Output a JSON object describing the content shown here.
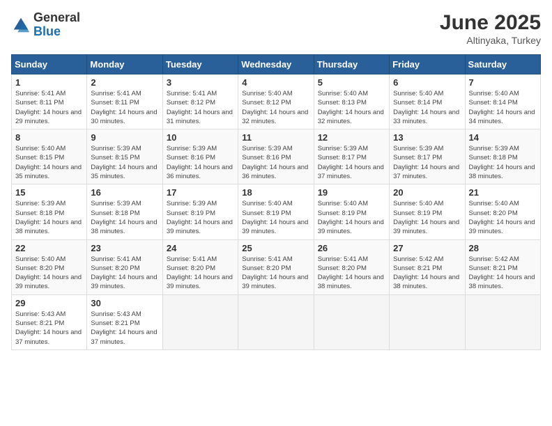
{
  "header": {
    "logo_general": "General",
    "logo_blue": "Blue",
    "month": "June 2025",
    "location": "Altinyaka, Turkey"
  },
  "weekdays": [
    "Sunday",
    "Monday",
    "Tuesday",
    "Wednesday",
    "Thursday",
    "Friday",
    "Saturday"
  ],
  "weeks": [
    [
      {
        "day": "1",
        "sunrise": "5:41 AM",
        "sunset": "8:11 PM",
        "daylight": "14 hours and 29 minutes."
      },
      {
        "day": "2",
        "sunrise": "5:41 AM",
        "sunset": "8:11 PM",
        "daylight": "14 hours and 30 minutes."
      },
      {
        "day": "3",
        "sunrise": "5:41 AM",
        "sunset": "8:12 PM",
        "daylight": "14 hours and 31 minutes."
      },
      {
        "day": "4",
        "sunrise": "5:40 AM",
        "sunset": "8:12 PM",
        "daylight": "14 hours and 32 minutes."
      },
      {
        "day": "5",
        "sunrise": "5:40 AM",
        "sunset": "8:13 PM",
        "daylight": "14 hours and 32 minutes."
      },
      {
        "day": "6",
        "sunrise": "5:40 AM",
        "sunset": "8:14 PM",
        "daylight": "14 hours and 33 minutes."
      },
      {
        "day": "7",
        "sunrise": "5:40 AM",
        "sunset": "8:14 PM",
        "daylight": "14 hours and 34 minutes."
      }
    ],
    [
      {
        "day": "8",
        "sunrise": "5:40 AM",
        "sunset": "8:15 PM",
        "daylight": "14 hours and 35 minutes."
      },
      {
        "day": "9",
        "sunrise": "5:39 AM",
        "sunset": "8:15 PM",
        "daylight": "14 hours and 35 minutes."
      },
      {
        "day": "10",
        "sunrise": "5:39 AM",
        "sunset": "8:16 PM",
        "daylight": "14 hours and 36 minutes."
      },
      {
        "day": "11",
        "sunrise": "5:39 AM",
        "sunset": "8:16 PM",
        "daylight": "14 hours and 36 minutes."
      },
      {
        "day": "12",
        "sunrise": "5:39 AM",
        "sunset": "8:17 PM",
        "daylight": "14 hours and 37 minutes."
      },
      {
        "day": "13",
        "sunrise": "5:39 AM",
        "sunset": "8:17 PM",
        "daylight": "14 hours and 37 minutes."
      },
      {
        "day": "14",
        "sunrise": "5:39 AM",
        "sunset": "8:18 PM",
        "daylight": "14 hours and 38 minutes."
      }
    ],
    [
      {
        "day": "15",
        "sunrise": "5:39 AM",
        "sunset": "8:18 PM",
        "daylight": "14 hours and 38 minutes."
      },
      {
        "day": "16",
        "sunrise": "5:39 AM",
        "sunset": "8:18 PM",
        "daylight": "14 hours and 38 minutes."
      },
      {
        "day": "17",
        "sunrise": "5:39 AM",
        "sunset": "8:19 PM",
        "daylight": "14 hours and 39 minutes."
      },
      {
        "day": "18",
        "sunrise": "5:40 AM",
        "sunset": "8:19 PM",
        "daylight": "14 hours and 39 minutes."
      },
      {
        "day": "19",
        "sunrise": "5:40 AM",
        "sunset": "8:19 PM",
        "daylight": "14 hours and 39 minutes."
      },
      {
        "day": "20",
        "sunrise": "5:40 AM",
        "sunset": "8:19 PM",
        "daylight": "14 hours and 39 minutes."
      },
      {
        "day": "21",
        "sunrise": "5:40 AM",
        "sunset": "8:20 PM",
        "daylight": "14 hours and 39 minutes."
      }
    ],
    [
      {
        "day": "22",
        "sunrise": "5:40 AM",
        "sunset": "8:20 PM",
        "daylight": "14 hours and 39 minutes."
      },
      {
        "day": "23",
        "sunrise": "5:41 AM",
        "sunset": "8:20 PM",
        "daylight": "14 hours and 39 minutes."
      },
      {
        "day": "24",
        "sunrise": "5:41 AM",
        "sunset": "8:20 PM",
        "daylight": "14 hours and 39 minutes."
      },
      {
        "day": "25",
        "sunrise": "5:41 AM",
        "sunset": "8:20 PM",
        "daylight": "14 hours and 39 minutes."
      },
      {
        "day": "26",
        "sunrise": "5:41 AM",
        "sunset": "8:20 PM",
        "daylight": "14 hours and 38 minutes."
      },
      {
        "day": "27",
        "sunrise": "5:42 AM",
        "sunset": "8:21 PM",
        "daylight": "14 hours and 38 minutes."
      },
      {
        "day": "28",
        "sunrise": "5:42 AM",
        "sunset": "8:21 PM",
        "daylight": "14 hours and 38 minutes."
      }
    ],
    [
      {
        "day": "29",
        "sunrise": "5:43 AM",
        "sunset": "8:21 PM",
        "daylight": "14 hours and 37 minutes."
      },
      {
        "day": "30",
        "sunrise": "5:43 AM",
        "sunset": "8:21 PM",
        "daylight": "14 hours and 37 minutes."
      },
      null,
      null,
      null,
      null,
      null
    ]
  ],
  "labels": {
    "sunrise": "Sunrise:",
    "sunset": "Sunset:",
    "daylight": "Daylight:"
  }
}
